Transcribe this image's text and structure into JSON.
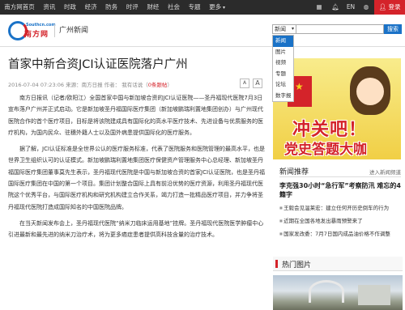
{
  "topbar": {
    "nav": [
      "南方网首页",
      "资讯",
      "时政",
      "经济",
      "防务",
      "时评",
      "财经",
      "社会",
      "专题",
      "更多"
    ],
    "en": "EN",
    "login": "登录"
  },
  "logo": {
    "site": "Southcn.com",
    "name": "南方网"
  },
  "section": "广州新闻",
  "search": {
    "selected": "新闻",
    "button": "搜索",
    "options": [
      "新闻",
      "图片",
      "视频",
      "专题",
      "论坛",
      "数字报"
    ],
    "highlighted_index": 0
  },
  "article": {
    "title": "首家中新合资JCI认证医院落户广州",
    "meta_prefix": "2016-07-04 07:23:06  来源：南方日报  作者：  我有话说（",
    "comments": "0条跟帖",
    "meta_suffix": "）",
    "font_small": "A",
    "font_large": "A",
    "paragraphs": [
      "南方日报讯（记者/欧阳江）全国首家中国与新加坡合资的JCI认证医院——圣丹福现代医院7月3日宣布落户广州并正式启动。它是新加坡圣丹福国际医疗集团（新加坡鹏瑞利置地集团创办）与广州现代医院合作的首个医疗项目，目标是将该院建成具有国际化的高水平医疗技术、先进设备与优质服务的医疗机构，为国内民众、驻穗外籍人士以及国外病患提供国际化的医疗服务。",
      "据了解，JCI认证标准是全世界公认的医疗服务标准，代表了医院服务和医院管理的最高水平，也是世界卫生组织认可的认证模式。新加坡鹏瑞利置地集团医疗保健资产管理服务中心总经理、新加坡圣丹福国际医疗集团董事莫先生表示，圣丹福现代医院是中国与新加坡合资的首家JCI认证医院，也是圣丹福国际医疗集团在中国的第一个项目。集团计划整合国际上具有前沿优势的医疗资源，利用圣丹福现代医院这个优秀平台，与国际医疗机构和研究机构建立合作关系，竭力打造一批精品医疗项目，并力争将圣丹福现代医院打造成国际知名的中国医院品牌。",
      "在当天新闻发布会上，圣丹福现代医院“纳米刀临床运用基地”挂牌。圣丹福现代医院医学肿瘤中心引进最新和最先进的纳米刀治疗术，将为更多癌症患者提供高科技含量的治疗技术。"
    ]
  },
  "ad": {
    "slogan1": "冲关吧！",
    "slogan2": "党史答题大咖"
  },
  "recommend": {
    "title": "新闻推荐",
    "more": "进入新闻频道",
    "top": "李克强30小时“急行军”考察防汛 难忘的4籍字",
    "items": [
      "王毅会见温莱宏：建立任何开历史倒车的行为",
      "近期在全国各地发出暴雨预警来了",
      "国家发改委：7月7日国内成品油价格不作调整"
    ]
  },
  "hot": {
    "title": "热门图片"
  }
}
